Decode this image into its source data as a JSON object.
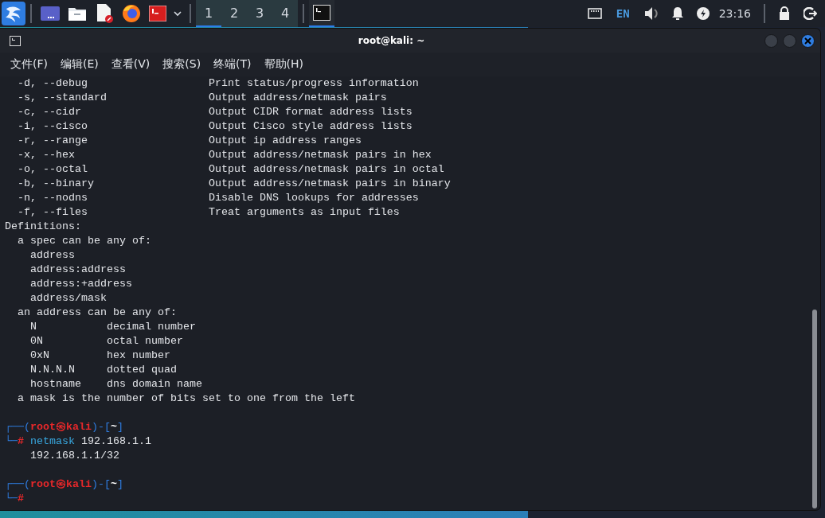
{
  "taskbar": {
    "workspaces": [
      {
        "label": "1",
        "selected": true
      },
      {
        "label": "2",
        "selected": false
      },
      {
        "label": "3",
        "selected": false
      },
      {
        "label": "4",
        "selected": false
      }
    ],
    "window_task": {
      "active": true
    },
    "tray": {
      "language": "EN",
      "clock": "23:16"
    }
  },
  "window": {
    "title": "root@kali: ~"
  },
  "menu": [
    {
      "label": "文件(F)"
    },
    {
      "label": "编辑(E)"
    },
    {
      "label": "查看(V)"
    },
    {
      "label": "搜索(S)"
    },
    {
      "label": "终端(T)"
    },
    {
      "label": "帮助(H)"
    }
  ],
  "terminal": {
    "lines": [
      {
        "kind": "option",
        "flag": "-d, --debug",
        "description": "Print status/progress information"
      },
      {
        "kind": "option",
        "flag": "-s, --standard",
        "description": "Output address/netmask pairs"
      },
      {
        "kind": "option",
        "flag": "-c, --cidr",
        "description": "Output CIDR format address lists"
      },
      {
        "kind": "option",
        "flag": "-i, --cisco",
        "description": "Output Cisco style address lists"
      },
      {
        "kind": "option",
        "flag": "-r, --range",
        "description": "Output ip address ranges"
      },
      {
        "kind": "option",
        "flag": "-x, --hex",
        "description": "Output address/netmask pairs in hex"
      },
      {
        "kind": "option",
        "flag": "-o, --octal",
        "description": "Output address/netmask pairs in octal"
      },
      {
        "kind": "option",
        "flag": "-b, --binary",
        "description": "Output address/netmask pairs in binary"
      },
      {
        "kind": "option",
        "flag": "-n, --nodns",
        "description": "Disable DNS lookups for addresses"
      },
      {
        "kind": "option",
        "flag": "-f, --files",
        "description": "Treat arguments as input files"
      },
      {
        "kind": "heading",
        "text": "Definitions:"
      },
      {
        "kind": "subheading",
        "text": "a spec can be any of:"
      },
      {
        "kind": "item",
        "text": "address"
      },
      {
        "kind": "item",
        "text": "address:address"
      },
      {
        "kind": "item",
        "text": "address:+address"
      },
      {
        "kind": "item",
        "text": "address/mask"
      },
      {
        "kind": "subheading",
        "text": "an address can be any of:"
      },
      {
        "kind": "format",
        "term": "N",
        "description": "decimal number"
      },
      {
        "kind": "format",
        "term": "0N",
        "description": "octal number"
      },
      {
        "kind": "format",
        "term": "0xN",
        "description": "hex number"
      },
      {
        "kind": "format",
        "term": "N.N.N.N",
        "description": "dotted quad"
      },
      {
        "kind": "format",
        "term": "hostname",
        "description": "dns domain name"
      },
      {
        "kind": "subheading",
        "text": "a mask is the number of bits set to one from the left"
      },
      {
        "kind": "blank"
      },
      {
        "kind": "prompt",
        "open": "┌──(",
        "user": "root",
        "at": "㉿",
        "host": "kali",
        "mid": ")-[",
        "dir": "~",
        "close": "]"
      },
      {
        "kind": "command",
        "corner": "└─",
        "sign": "#",
        "command": "netmask",
        "args": "192.168.1.1"
      },
      {
        "kind": "output",
        "text": "192.168.1.1/32"
      },
      {
        "kind": "blank"
      },
      {
        "kind": "prompt",
        "open": "┌──(",
        "user": "root",
        "at": "㉿",
        "host": "kali",
        "mid": ")-[",
        "dir": "~",
        "close": "]"
      },
      {
        "kind": "command",
        "corner": "└─",
        "sign": "#"
      }
    ]
  }
}
